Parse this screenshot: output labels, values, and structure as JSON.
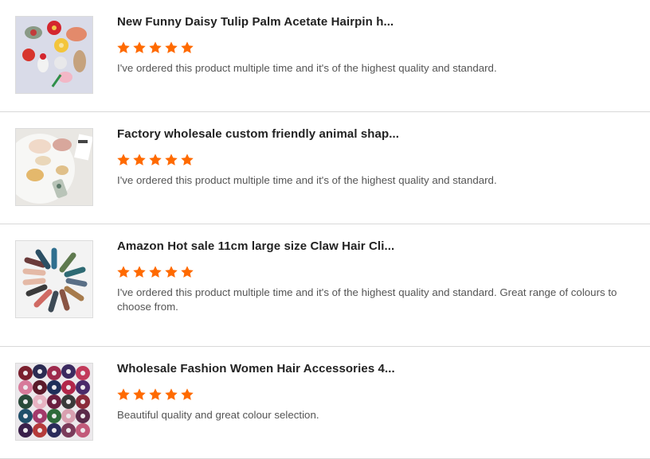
{
  "reviews": [
    {
      "title": "New Funny Daisy Tulip Palm Acetate Hairpin h...",
      "rating": 5,
      "comment": "I've ordered this product multiple time and it's of the highest quality and standard.",
      "image_icon": "hairpin-product-photo"
    },
    {
      "title": "Factory wholesale custom friendly animal shap...",
      "rating": 5,
      "comment": "I've ordered this product multiple time and it's of the highest quality and standard.",
      "image_icon": "hair-clip-product-photo"
    },
    {
      "title": "Amazon Hot sale 11cm large size Claw Hair Cli...",
      "rating": 5,
      "comment": "I've ordered this product multiple time and it's of the highest quality and standard. Great range of colours to choose from.",
      "image_icon": "claw-clip-product-photo"
    },
    {
      "title": "Wholesale Fashion Women Hair Accessories 4...",
      "rating": 5,
      "comment": "Beautiful quality and great colour selection.",
      "image_icon": "scrunchies-product-photo"
    }
  ],
  "colors": {
    "star": "#ff6a00",
    "title": "#222222",
    "comment": "#555555",
    "divider": "#d9d9d9"
  }
}
